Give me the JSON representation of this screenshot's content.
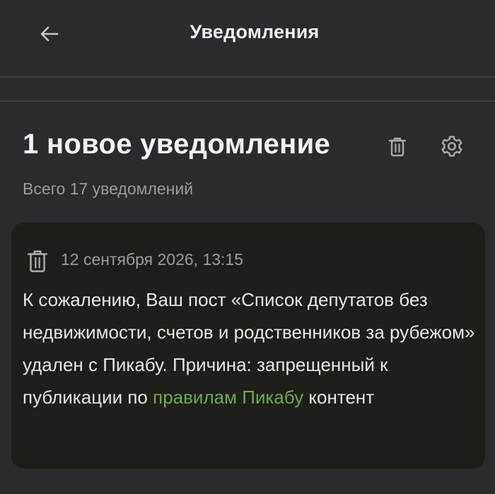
{
  "header": {
    "back_icon": "arrow-left-icon",
    "title": "Уведомления"
  },
  "main": {
    "title": "1 новое уведомление",
    "subtitle": "Всего 17 уведомлений",
    "delete_all_icon": "trash-icon",
    "settings_icon": "gear-icon"
  },
  "notification": {
    "delete_icon": "trash-icon",
    "date": "12 сентября 2026, 13:15",
    "text_before_link": "К сожалению, Ваш пост «Список депутатов без недвижимости, счетов и родственников за рубежом» удален с Пикабу. Причина: запрещенный к публикации по ",
    "link_text": "правилам Пикабу",
    "text_after_link": " контент"
  },
  "colors": {
    "background": "#2a2b2f",
    "card_background": "#1e1e1b",
    "text": "#e6e6e6",
    "muted_text": "#9a9b9f",
    "link": "#6fa658",
    "divider": "#3c3d42"
  }
}
